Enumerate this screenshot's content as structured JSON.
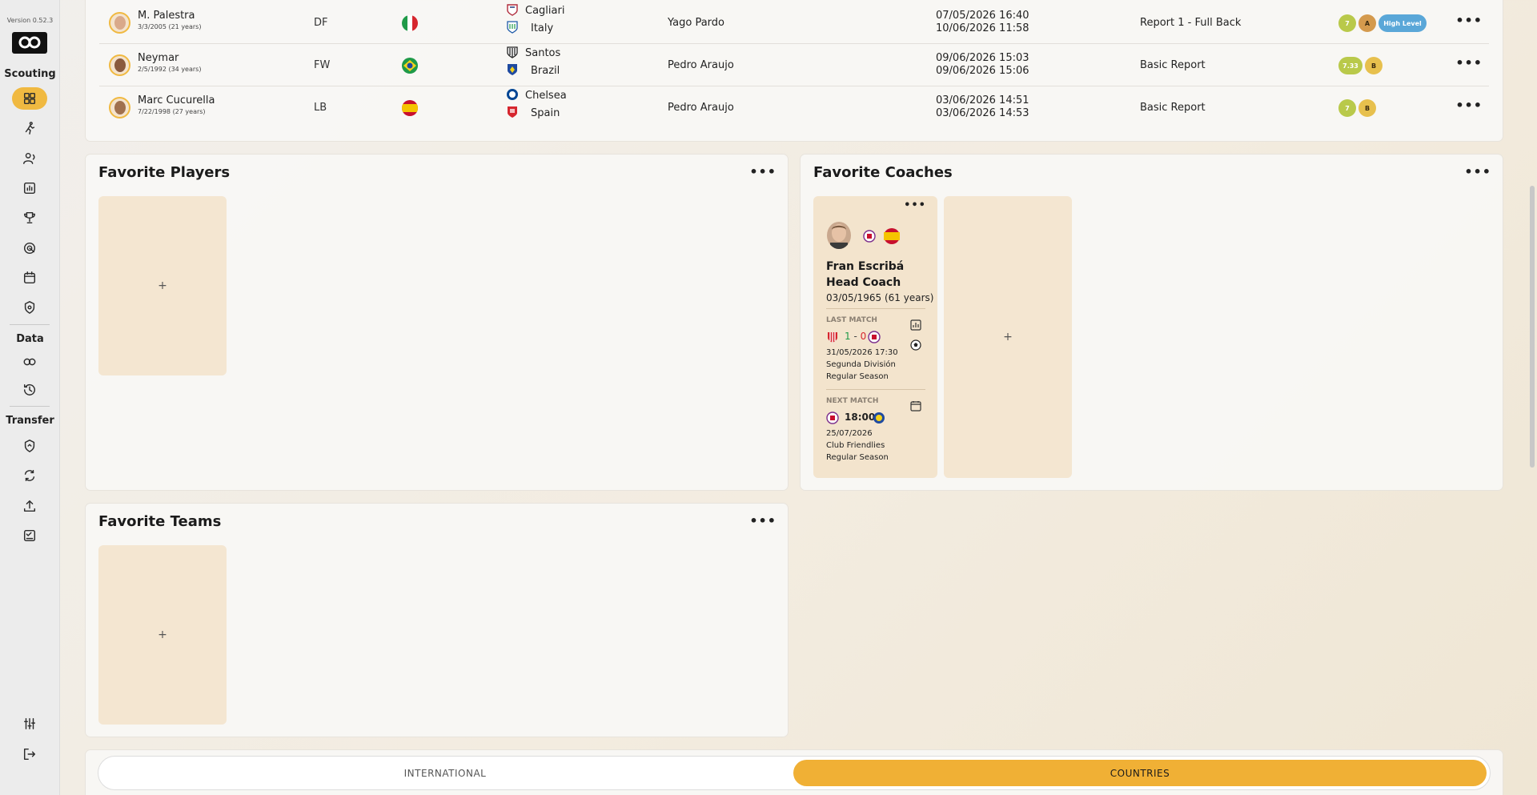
{
  "sidebar": {
    "version": "Version 0.52.3",
    "sections": {
      "scouting": "Scouting",
      "data": "Data",
      "transfer": "Transfer"
    }
  },
  "table": {
    "rows": [
      {
        "name": "M. Palestra",
        "dob": "3/3/2005 (21 years)",
        "position": "DF",
        "club": "Cagliari",
        "country": "Italy",
        "scout": "Yago Pardo",
        "created": "07/05/2026 16:40",
        "updated": "10/06/2026 11:58",
        "report": "Report 1 - Full Back",
        "badges": [
          "7",
          "A",
          "High Level"
        ]
      },
      {
        "name": "Neymar",
        "dob": "2/5/1992 (34 years)",
        "position": "FW",
        "club": "Santos",
        "country": "Brazil",
        "scout": "Pedro Araujo",
        "created": "09/06/2026 15:03",
        "updated": "09/06/2026 15:06",
        "report": "Basic Report",
        "badges": [
          "7.33",
          "B"
        ]
      },
      {
        "name": "Marc Cucurella",
        "dob": "7/22/1998 (27 years)",
        "position": "LB",
        "club": "Chelsea",
        "country": "Spain",
        "scout": "Pedro Araujo",
        "created": "03/06/2026 14:51",
        "updated": "03/06/2026 14:53",
        "report": "Basic Report",
        "badges": [
          "7",
          "B"
        ]
      }
    ]
  },
  "favorites": {
    "players": {
      "title": "Favorite Players",
      "add": "+"
    },
    "coaches": {
      "title": "Favorite Coaches",
      "add": "+",
      "coach": {
        "name": "Fran Escribá",
        "role": "Head Coach",
        "dob": "03/05/1965 (61 years)",
        "last_match": {
          "label": "LAST MATCH",
          "score_home": "1",
          "score_sep": " - ",
          "score_away": "0",
          "date": "31/05/2026 17:30",
          "competition": "Segunda División",
          "stage": "Regular Season"
        },
        "next_match": {
          "label": "NEXT MATCH",
          "time": "18:00",
          "date": "25/07/2026",
          "competition": "Club Friendlies",
          "stage": "Regular Season"
        }
      }
    },
    "teams": {
      "title": "Favorite Teams",
      "add": "+"
    }
  },
  "toggle": {
    "left": "INTERNATIONAL",
    "right": "COUNTRIES",
    "active": "right"
  },
  "colors": {
    "accent": "#f0b941",
    "badge_green": "#b9c94a",
    "badge_a": "#d49a4d",
    "badge_b": "#e7c04d",
    "badge_blue": "#5aa7d8"
  },
  "more_label": "•••"
}
